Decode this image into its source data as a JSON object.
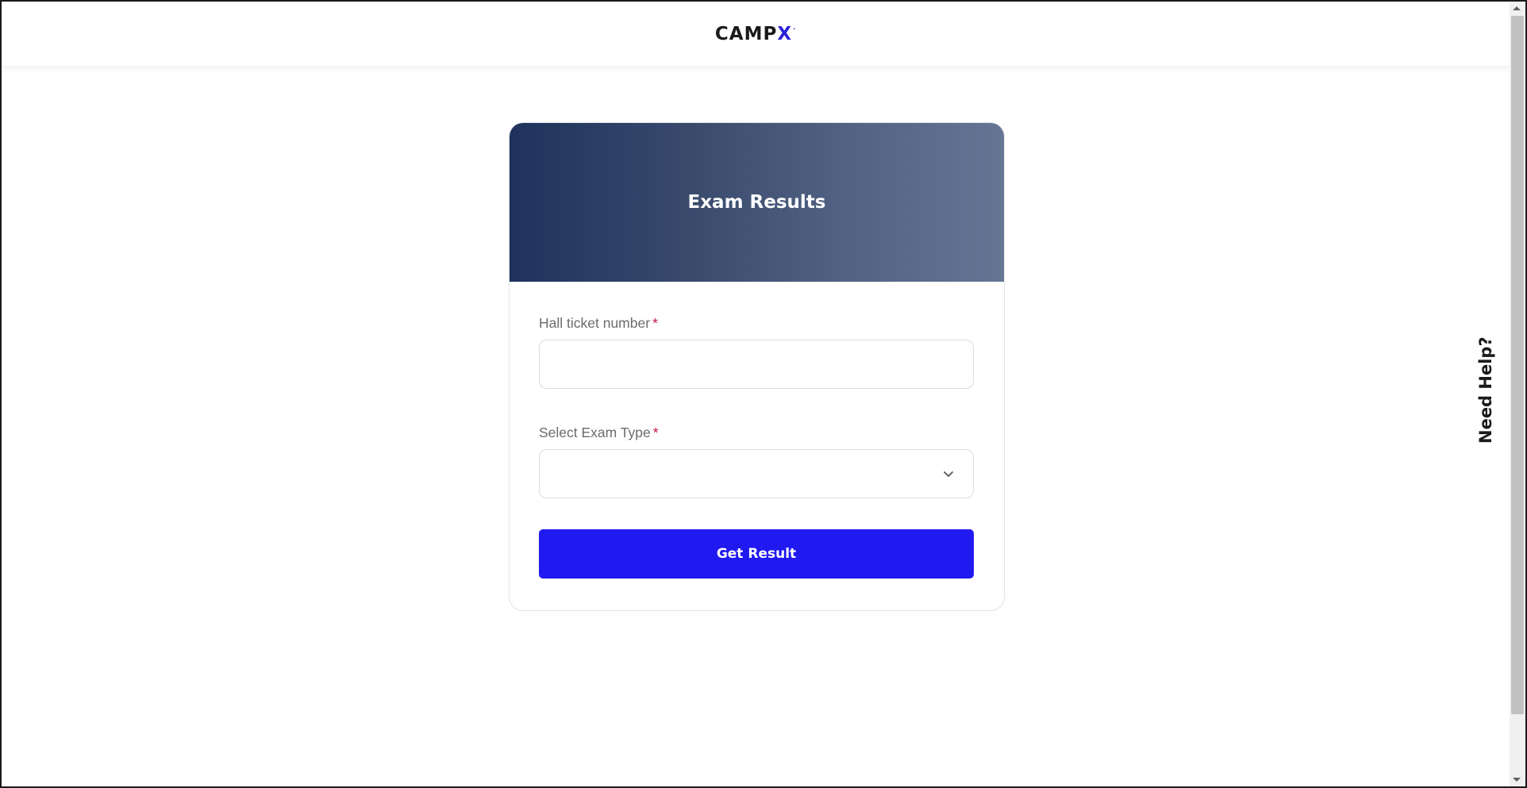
{
  "header": {
    "logo_main": "CAMP",
    "logo_accent": "X",
    "logo_mark": "·"
  },
  "card": {
    "title": "Exam Results",
    "hall_ticket": {
      "label": "Hall ticket number",
      "required_mark": "*",
      "value": "",
      "placeholder": ""
    },
    "exam_type": {
      "label": "Select Exam Type",
      "required_mark": "*",
      "selected": "",
      "icon": "chevron-down-icon"
    },
    "submit_label": "Get Result"
  },
  "help_tab": {
    "label": "Need Help?"
  },
  "colors": {
    "header_gradient_start": "#1e325c",
    "header_gradient_end": "#657594",
    "primary_button": "#2019f0",
    "logo_accent": "#2b22d6",
    "required": "#c0143c"
  }
}
